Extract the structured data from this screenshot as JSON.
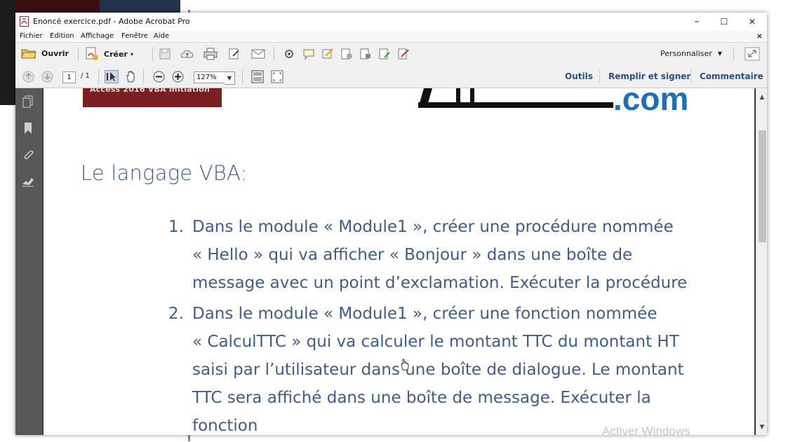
{
  "window": {
    "title": "Enoncé exercice.pdf - Adobe Acrobat Pro",
    "controls": {
      "minimize": "–",
      "maximize": "☐",
      "close": "✕"
    }
  },
  "menu": {
    "items": [
      "Fichier",
      "Edition",
      "Affichage",
      "Fenêtre",
      "Aide"
    ],
    "close": "×"
  },
  "toolbar": {
    "open_label": "Ouvrir",
    "create_label": "Créer",
    "customize_label": "Personnaliser"
  },
  "nav": {
    "page_current": "1",
    "page_total": "/ 1",
    "zoom": "127%",
    "tools": "Outils",
    "fill_sign": "Remplir et signer",
    "comment": "Commentaire"
  },
  "document": {
    "banner_text": "Access 2016 VBA initiation",
    "logo_suffix": ".com",
    "heading": "Le langage VBA:",
    "items": [
      {
        "number": "1.",
        "lines": [
          "Dans le module « Module1 », créer une procédure nommée",
          "« Hello » qui va afficher « Bonjour » dans une boîte de",
          "message avec un point d’exclamation. Exécuter la procédure"
        ]
      },
      {
        "number": "2.",
        "lines": [
          "Dans le module « Module1 », créer une fonction nommée",
          "« CalculTTC » qui va calculer le montant TTC du montant HT",
          "saisi par l’utilisateur dans une boîte de dialogue. Le montant",
          "TTC sera affiché dans une boîte de message. Exécuter la",
          "fonction"
        ]
      }
    ]
  },
  "watermark": "Activer Windows",
  "colors": {
    "text_blue": "#3d5c8f",
    "link_blue": "#2a4e86",
    "logo_blue": "#1f6fb6"
  }
}
